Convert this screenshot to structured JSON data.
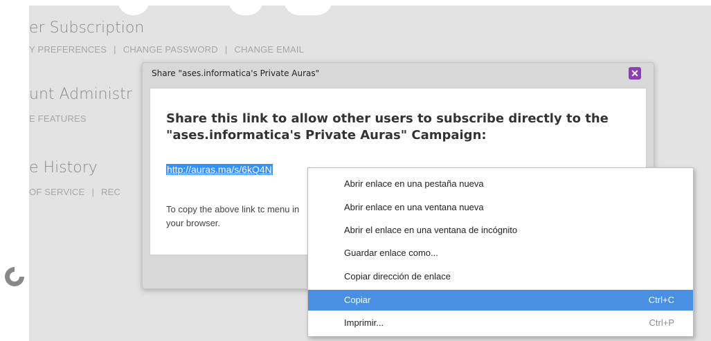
{
  "background": {
    "heading1": "er Subscription",
    "links1": [
      "Y PREFERENCES",
      "CHANGE PASSWORD",
      "CHANGE EMAIL"
    ],
    "heading2": "unt Administr",
    "links2": [
      "E FEATURES"
    ],
    "heading3": "e History",
    "links3": [
      "OF SERVICE",
      "REC"
    ]
  },
  "dialog": {
    "title": "Share \"ases.informatica's Private Auras\"",
    "heading": "Share this link to allow other users to subscribe directly to the \"ases.informatica's Private Auras\" Campaign:",
    "link": "http://auras.ma/s/6kQ4N",
    "instructions": "To copy the above link tc menu in your browser."
  },
  "context_menu": {
    "items": [
      {
        "label": "Abrir enlace en una pestaña nueva",
        "shortcut": ""
      },
      {
        "label": "Abrir enlace en una ventana nueva",
        "shortcut": ""
      },
      {
        "label": "Abrir el enlace en una ventana de incógnito",
        "shortcut": ""
      },
      {
        "label": "Guardar enlace como...",
        "shortcut": ""
      },
      {
        "label": "Copiar dirección de enlace",
        "shortcut": ""
      },
      {
        "label": "Copiar",
        "shortcut": "Ctrl+C",
        "selected": true
      },
      {
        "label": "Imprimir...",
        "shortcut": "Ctrl+P"
      }
    ]
  },
  "colors": {
    "close_button": "#8b3fb0",
    "selection": "#4a90e2",
    "link_highlight": "#3390ff"
  }
}
